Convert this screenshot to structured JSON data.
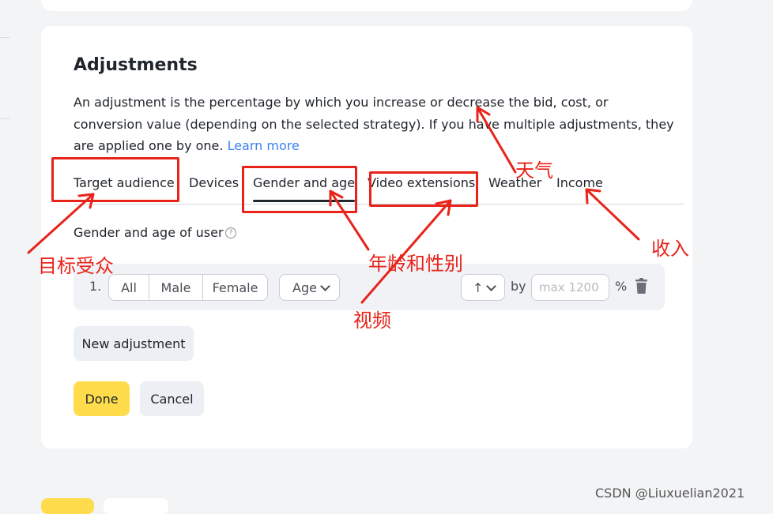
{
  "section": {
    "title": "Adjustments",
    "description": "An adjustment is the percentage by which you increase or decrease the bid, cost, or conversion value (depending on the selected strategy). If you have multiple adjustments, they are applied one by one.",
    "learn_more": "Learn more"
  },
  "tabs": [
    {
      "label": "Target audience",
      "active": false
    },
    {
      "label": "Devices",
      "active": false
    },
    {
      "label": "Gender and age",
      "active": true
    },
    {
      "label": "Video extensions",
      "active": false
    },
    {
      "label": "Weather",
      "active": false
    },
    {
      "label": "Income",
      "active": false
    }
  ],
  "gender_age": {
    "label": "Gender and age of user",
    "help_icon": "question-circle-icon",
    "row_number": "1.",
    "gender_options": [
      "All",
      "Male",
      "Female"
    ],
    "age_select": "Age",
    "direction_select": "↑",
    "by_label": "by",
    "value_placeholder": "max 1200",
    "percent_symbol": "%"
  },
  "buttons": {
    "new_adjustment": "New adjustment",
    "done": "Done",
    "cancel": "Cancel"
  },
  "annotations": {
    "target_audience": "目标受众",
    "gender_age": "年龄和性别",
    "video": "视频",
    "weather": "天气",
    "income": "收入"
  },
  "watermark": "CSDN @Liuxuelian2021",
  "colors": {
    "accent_yellow": "#fedc4c",
    "link_blue": "#3b82f6",
    "annotation_red": "#e8231a"
  }
}
